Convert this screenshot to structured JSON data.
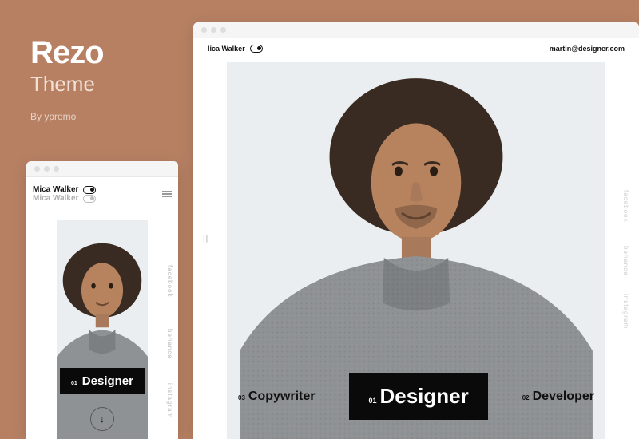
{
  "promo": {
    "name": "Rezo",
    "subtitle": "Theme",
    "byline": "By ypromo"
  },
  "mobile": {
    "identity": {
      "name": "Mica Walker",
      "name_dim": "Mica Walker"
    },
    "role": {
      "num": "01",
      "label": "Designer"
    },
    "scroll_glyph": "↓",
    "social": {
      "a": "facebook",
      "b": "behance",
      "c": "instagram"
    }
  },
  "desktop": {
    "identity": {
      "name": "lica Walker"
    },
    "email": "martin@designer.com",
    "handle": "||",
    "roles": {
      "left": {
        "num": "03",
        "label": "Copywriter"
      },
      "center": {
        "num": "01",
        "label": "Designer"
      },
      "right": {
        "num": "02",
        "label": "Developer"
      }
    },
    "social": {
      "a": "facebook",
      "b": "behance",
      "c": "instagram"
    }
  },
  "colors": {
    "bg": "#b78063",
    "ink": "#0a0a0a"
  }
}
